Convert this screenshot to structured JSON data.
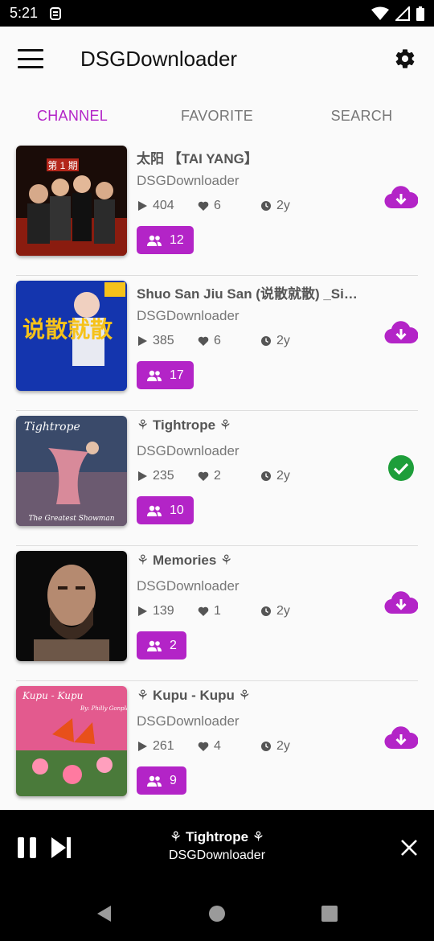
{
  "status_bar": {
    "time": "5:21"
  },
  "app_bar": {
    "title": "DSGDownloader"
  },
  "tabs": [
    {
      "label": "CHANNEL",
      "active": true
    },
    {
      "label": "FAVORITE",
      "active": false
    },
    {
      "label": "SEARCH",
      "active": false
    }
  ],
  "items": [
    {
      "title": "太阳 【TAI YANG】",
      "channel": "DSGDownloader",
      "plays": "404",
      "likes": "6",
      "age": "2y",
      "members": "12",
      "status": "download"
    },
    {
      "title": "Shuo San Jiu San (说散就散) _Sin...",
      "channel": "DSGDownloader",
      "plays": "385",
      "likes": "6",
      "age": "2y",
      "members": "17",
      "status": "download"
    },
    {
      "title": "⚘ Tightrope ⚘",
      "channel": "DSGDownloader",
      "plays": "235",
      "likes": "2",
      "age": "2y",
      "members": "10",
      "status": "downloaded"
    },
    {
      "title": "⚘ Memories ⚘",
      "channel": "DSGDownloader",
      "plays": "139",
      "likes": "1",
      "age": "2y",
      "members": "2",
      "status": "download"
    },
    {
      "title": "⚘ Kupu - Kupu ⚘",
      "channel": "DSGDownloader",
      "plays": "261",
      "likes": "4",
      "age": "2y",
      "members": "9",
      "status": "download"
    }
  ],
  "thumbnails": [
    {
      "text": "第 1 期"
    },
    {
      "text": "说散就散"
    },
    {
      "text": "Tightrope",
      "caption": "The Greatest Showman"
    },
    {
      "text": ""
    },
    {
      "text": "Kupu - Kupu",
      "caption": "By: Philly Gonplace"
    }
  ],
  "player": {
    "title": "⚘ Tightrope ⚘",
    "channel": "DSGDownloader"
  },
  "colors": {
    "accent": "#b324c7",
    "success": "#1e9e3a",
    "text": "#333333"
  }
}
